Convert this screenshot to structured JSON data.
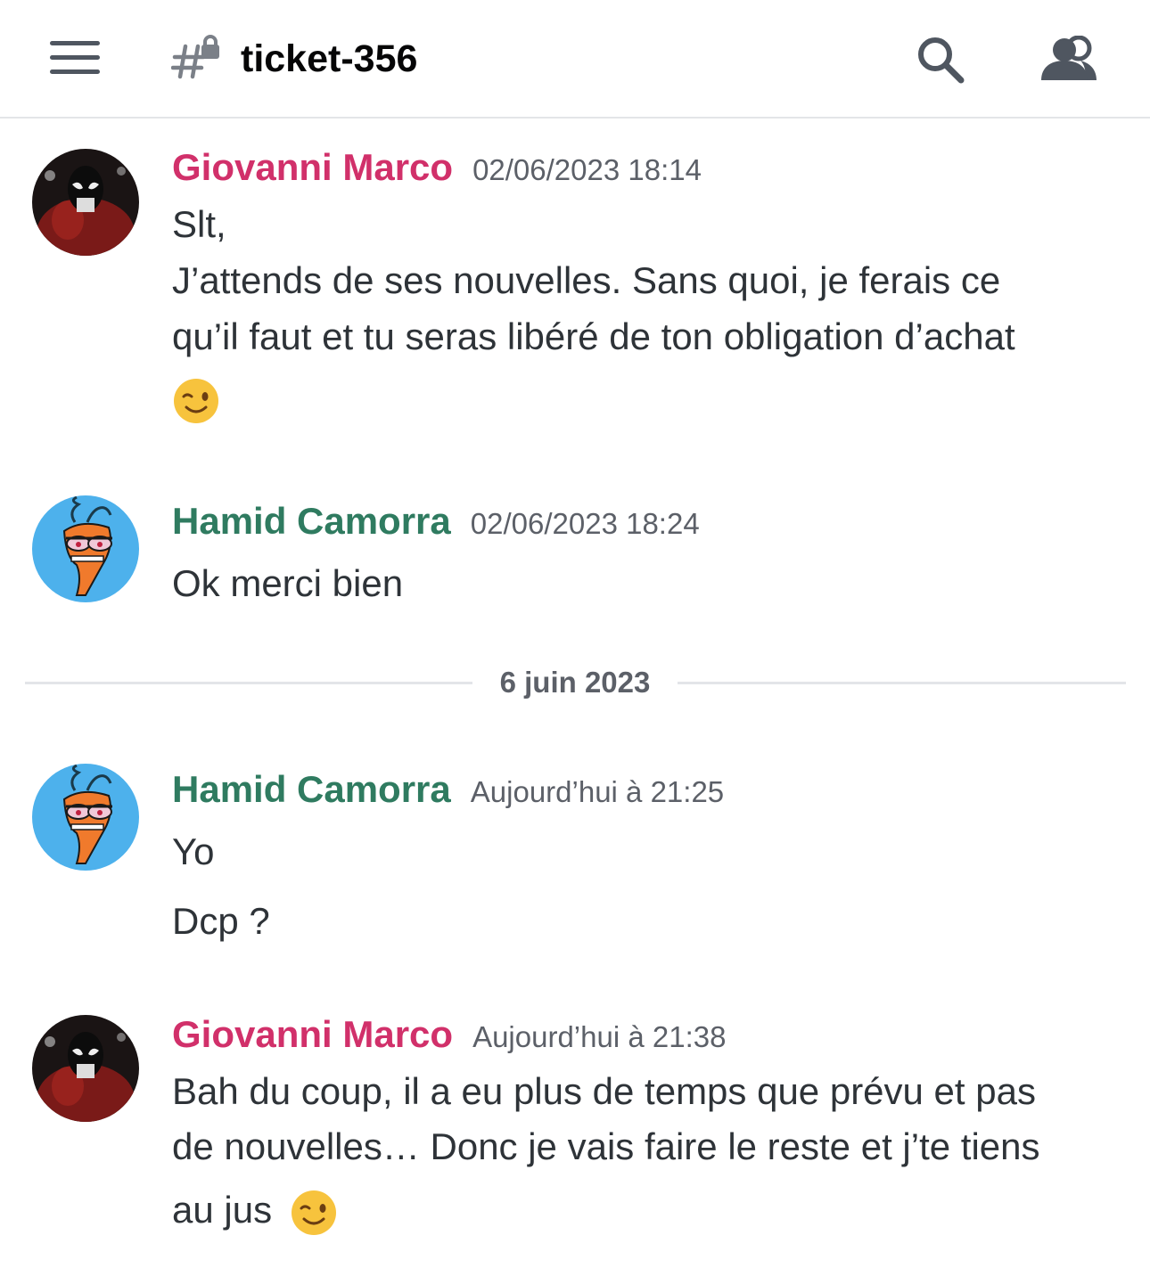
{
  "header": {
    "menu_icon": "hamburger-menu-icon",
    "channel_icon": "private-channel-hash-lock-icon",
    "channel_name": "ticket-356",
    "search_icon": "search-icon",
    "members_icon": "members-icon"
  },
  "colors": {
    "giovanni": "#d1306a",
    "hamid": "#2f7b60",
    "timestamp": "#5c6068",
    "divider": "#e3e5e8"
  },
  "messages": [
    {
      "author": "Giovanni Marco",
      "timestamp": "02/06/2023 18:14",
      "lines": [
        "Slt,",
        "J’attends de ses nouvelles. Sans quoi, je ferais ce",
        "qu’il faut et tu seras libéré de ton obligation d’achat"
      ],
      "emoji": "winking-face-emoji"
    },
    {
      "author": "Hamid Camorra",
      "timestamp": "02/06/2023 18:24",
      "lines": [
        "Ok merci bien"
      ]
    },
    {
      "author": "Hamid Camorra",
      "timestamp": "Aujourd’hui à 21:25",
      "lines": [
        "Yo",
        "Dcp ?"
      ]
    },
    {
      "author": "Giovanni Marco",
      "timestamp": "Aujourd’hui à 21:38",
      "lines": [
        "Bah du coup, il a eu plus de temps que prévu et pas",
        "de nouvelles… Donc je vais faire le reste et j’te tiens",
        "au jus"
      ],
      "emoji": "winking-face-emoji"
    }
  ],
  "date_divider": "6 juin 2023"
}
